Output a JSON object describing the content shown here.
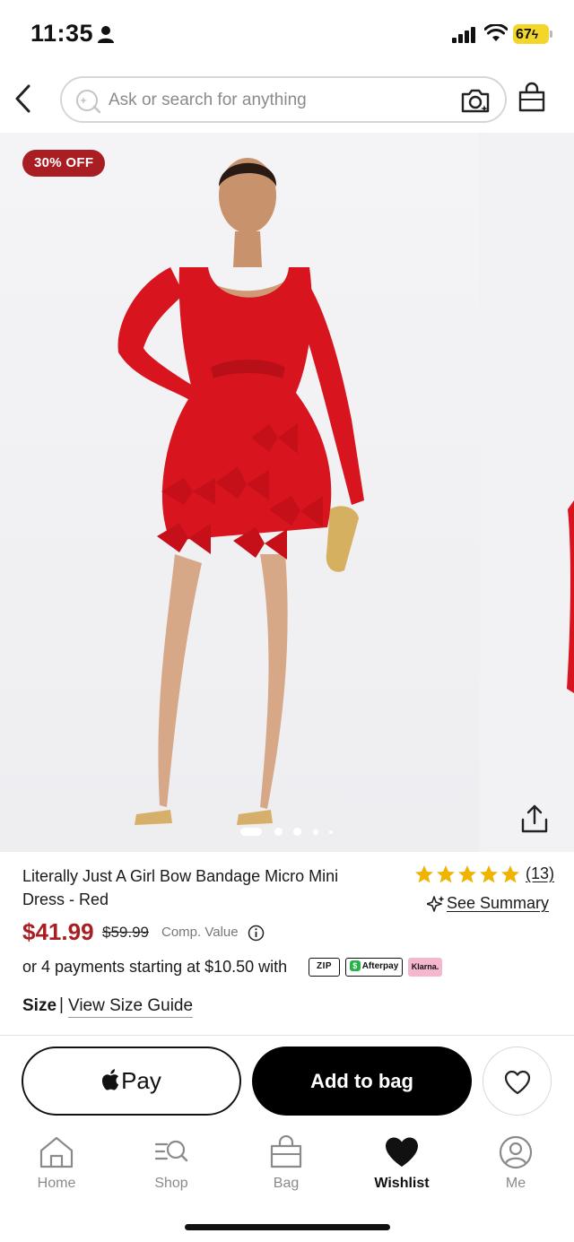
{
  "status_bar": {
    "time": "11:35",
    "battery": "67"
  },
  "search": {
    "placeholder": "Ask or search for anything"
  },
  "product": {
    "badge": "30% OFF",
    "title": "Literally Just A Girl Bow Bandage Micro Mini Dress - Red",
    "rating_count": "(13)",
    "rating": 4.5,
    "see_summary": "See Summary",
    "price": "$41.99",
    "old_price": "$59.99",
    "comp_value": "Comp. Value",
    "payments": "or 4 payments starting at $10.50 with",
    "pay_logos": {
      "zip": "ZIP",
      "afterpay": "Afterpay",
      "klarna": "Klarna."
    },
    "size_label": "Size",
    "size_sep": "|",
    "size_guide": "View Size Guide",
    "image_dots": {
      "count": 5,
      "active": 0
    }
  },
  "actions": {
    "apple_pay": "Pay",
    "add_to_bag": "Add to bag"
  },
  "tabs": [
    {
      "label": "Home",
      "icon": "home-icon"
    },
    {
      "label": "Shop",
      "icon": "shop-search-icon"
    },
    {
      "label": "Bag",
      "icon": "bag-icon"
    },
    {
      "label": "Wishlist",
      "icon": "heart-icon",
      "active": true
    },
    {
      "label": "Me",
      "icon": "profile-icon"
    }
  ],
  "colors": {
    "accent": "#a81e22",
    "star": "#f0b400",
    "model_dress": "#d8141e"
  }
}
